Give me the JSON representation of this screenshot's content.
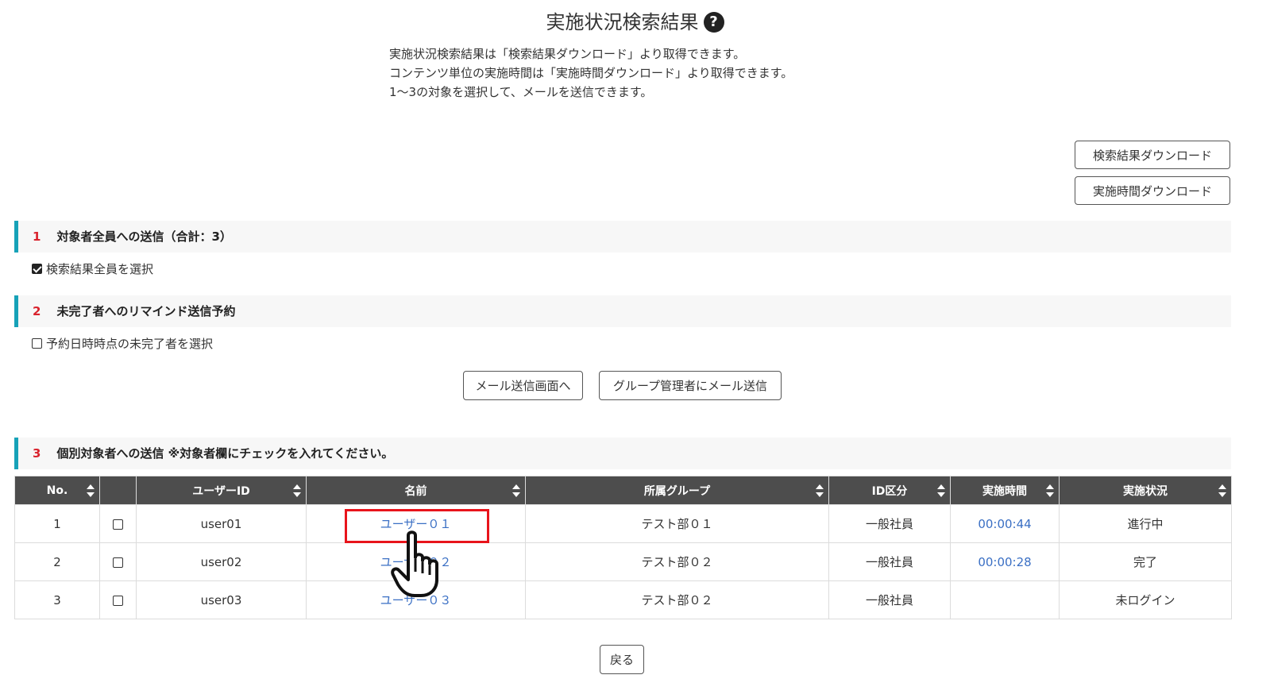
{
  "page": {
    "title": "実施状況検索結果",
    "help_icon": "help-circle-icon",
    "help_glyph": "?",
    "intro_lines": [
      "実施状況検索結果は「検索結果ダウンロード」より取得できます。",
      "コンテンツ単位の実施時間は「実施時間ダウンロード」より取得できます。",
      "1〜3の対象を選択して、メールを送信できます。"
    ]
  },
  "downloads": {
    "search_results_label": "検索結果ダウンロード",
    "duration_label": "実施時間ダウンロード"
  },
  "section1": {
    "num": "1",
    "title": "対象者全員への送信（合計：3）",
    "checkbox_label": "検索結果全員を選択",
    "checked": true
  },
  "section2": {
    "num": "2",
    "title": "未完了者へのリマインド送信予約",
    "checkbox_label": "予約日時時点の未完了者を選択",
    "checked": false
  },
  "mail_buttons": {
    "mail_screen_label": "メール送信画面へ",
    "group_admin_label": "グループ管理者にメール送信"
  },
  "section3": {
    "num": "3",
    "title": "個別対象者への送信 ※対象者欄にチェックを入れてください。"
  },
  "table": {
    "headers": {
      "no": "No.",
      "check": "",
      "user_id": "ユーザーID",
      "name": "名前",
      "group": "所属グループ",
      "id_type": "ID区分",
      "duration": "実施時間",
      "status": "実施状況"
    },
    "rows": [
      {
        "no": "1",
        "user_id": "user01",
        "name": "ユーザー０１",
        "group": "テスト部０１",
        "id_type": "一般社員",
        "duration": "00:00:44",
        "status": "進行中"
      },
      {
        "no": "2",
        "user_id": "user02",
        "name": "ユーザー０２",
        "group": "テスト部０２",
        "id_type": "一般社員",
        "duration": "00:00:28",
        "status": "完了"
      },
      {
        "no": "3",
        "user_id": "user03",
        "name": "ユーザー０３",
        "group": "テスト部０２",
        "id_type": "一般社員",
        "duration": "",
        "status": "未ログイン"
      }
    ]
  },
  "footer": {
    "back_label": "戻る"
  },
  "colors": {
    "accent_bar": "#17a2b8",
    "section_number": "#d9232d",
    "table_header_bg": "#4d4d4d",
    "link": "#3a6fc4",
    "highlight_box": "#e8141b"
  },
  "annotations": {
    "pointer_icon": "hand-pointer-icon"
  }
}
